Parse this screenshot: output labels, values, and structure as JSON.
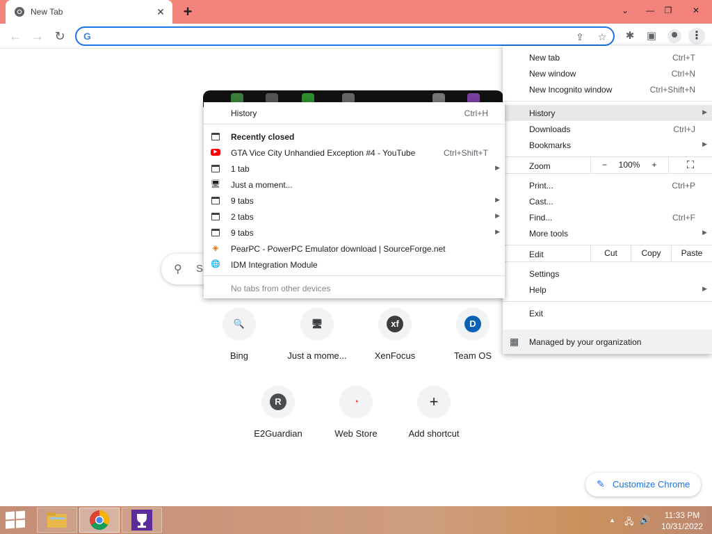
{
  "window": {
    "tab_title": "New Tab",
    "tab_close": "✕",
    "new_tab": "+",
    "controls": {
      "dropdown": "⌄",
      "minimize": "—",
      "restore": "❐",
      "close": "✕"
    }
  },
  "toolbar": {
    "back": "←",
    "forward": "→",
    "reload": "↻",
    "omnibox_value": "",
    "omnibox_icon": "G",
    "share": "⇪",
    "star": "☆",
    "extensions": "✱",
    "sidepanel": "▣",
    "menu": "⋮"
  },
  "ntp": {
    "search_partial": "S",
    "search_icon": "⚲",
    "shortcuts": [
      {
        "label": "Bing",
        "glyph": "🔍",
        "glyph_color": "#1a73e8",
        "glyph_bg": "transparent"
      },
      {
        "label": "Just a mome...",
        "glyph": "🖥",
        "glyph_color": "#3c4043",
        "glyph_bg": "transparent"
      },
      {
        "label": "XenFocus",
        "glyph": "xf",
        "glyph_color": "#ffffff",
        "glyph_bg": "#3c3c3c"
      },
      {
        "label": "Team OS",
        "glyph": "D",
        "glyph_color": "#ffffff",
        "glyph_bg": "#0b62b5"
      },
      {
        "label": "E2Guardian",
        "glyph": "R",
        "glyph_color": "#ffffff",
        "glyph_bg": "#4a4e54"
      },
      {
        "label": "Web Store",
        "glyph": "◔",
        "glyph_color": "#ea4335",
        "glyph_bg": "transparent"
      },
      {
        "label": "Add shortcut",
        "glyph": "+",
        "glyph_color": "#202124",
        "glyph_bg": "transparent"
      }
    ],
    "customize_label": "Customize Chrome",
    "customize_icon": "✎"
  },
  "main_menu": {
    "items": [
      {
        "label": "New tab",
        "shortcut": "Ctrl+T"
      },
      {
        "label": "New window",
        "shortcut": "Ctrl+N"
      },
      {
        "label": "New Incognito window",
        "shortcut": "Ctrl+Shift+N"
      },
      {
        "label": "History",
        "shortcut": ""
      },
      {
        "label": "Downloads",
        "shortcut": "Ctrl+J"
      },
      {
        "label": "Bookmarks",
        "shortcut": ""
      },
      {
        "label": "Print...",
        "shortcut": "Ctrl+P"
      },
      {
        "label": "Cast...",
        "shortcut": ""
      },
      {
        "label": "Find...",
        "shortcut": "Ctrl+F"
      },
      {
        "label": "More tools",
        "shortcut": ""
      },
      {
        "label": "Settings",
        "shortcut": ""
      },
      {
        "label": "Help",
        "shortcut": ""
      },
      {
        "label": "Exit",
        "shortcut": ""
      }
    ],
    "zoom": {
      "label": "Zoom",
      "minus": "−",
      "value": "100%",
      "plus": "+",
      "fullscreen": "⛶"
    },
    "edit": {
      "label": "Edit",
      "cut": "Cut",
      "copy": "Copy",
      "paste": "Paste"
    },
    "managed": "Managed by your organization",
    "arrow": "▶"
  },
  "history_menu": {
    "header": {
      "label": "History",
      "shortcut": "Ctrl+H"
    },
    "recently_closed": "Recently closed",
    "entries": [
      {
        "label": "GTA Vice City Unhandied Exception #4 - YouTube",
        "shortcut": "Ctrl+Shift+T",
        "icon": "▶"
      },
      {
        "label": "1 tab"
      },
      {
        "label": "Just a moment...",
        "icon": "🖥"
      },
      {
        "label": "9 tabs"
      },
      {
        "label": "2 tabs"
      },
      {
        "label": "9 tabs"
      },
      {
        "label": "PearPC - PowerPC Emulator download | SourceForge.net",
        "icon": "◈"
      },
      {
        "label": "IDM Integration Module",
        "icon": "🌐"
      }
    ],
    "other_devices": "No tabs from other devices"
  },
  "taskbar": {
    "time": "11:33 PM",
    "date": "10/31/2022",
    "tray_up": "▲",
    "network": "🖧",
    "volume": "🔊"
  },
  "colors": {
    "titlebar": "#f2837a",
    "accent": "#1a73e8",
    "menu_highlight": "#e8e8e8"
  }
}
